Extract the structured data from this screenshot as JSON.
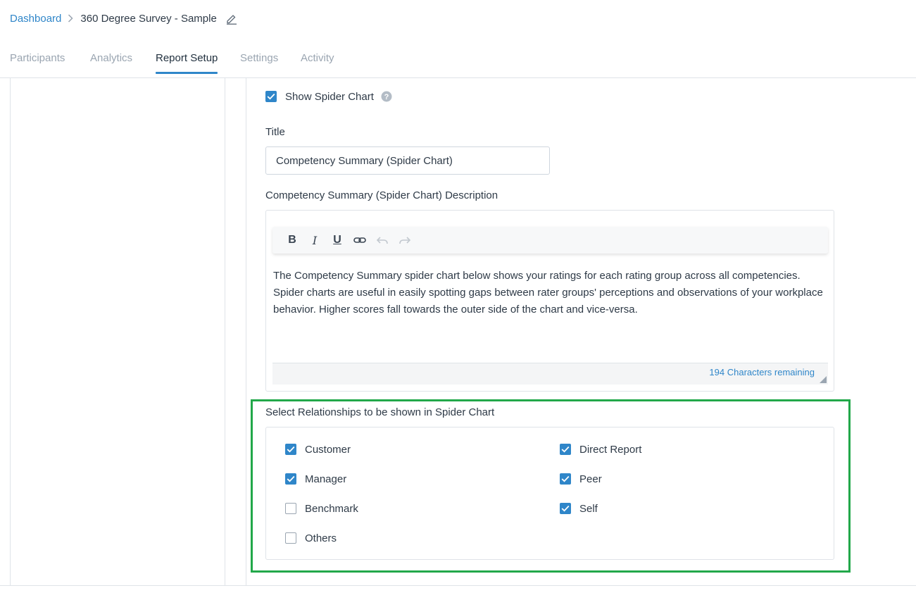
{
  "breadcrumb": {
    "root": "Dashboard",
    "current": "360 Degree Survey - Sample"
  },
  "tabs": [
    {
      "label": "Participants",
      "active": false
    },
    {
      "label": "Analytics",
      "active": false
    },
    {
      "label": "Report Setup",
      "active": true
    },
    {
      "label": "Settings",
      "active": false
    },
    {
      "label": "Activity",
      "active": false
    }
  ],
  "spider_chart": {
    "show_label": "Show Spider Chart",
    "show_checked": true,
    "title_label": "Title",
    "title_value": "Competency Summary (Spider Chart)",
    "description_label": "Competency Summary (Spider Chart) Description",
    "toolbar": {
      "bold": "B",
      "italic": "I",
      "underline": "U"
    },
    "description_text": "The Competency Summary spider chart below shows your ratings for each rating group across all competencies. Spider charts are useful in easily spotting gaps between rater groups' perceptions and observations of your workplace behavior. Higher scores fall towards the outer side of the chart and vice-versa.",
    "characters_remaining": "194 Characters remaining"
  },
  "relationships": {
    "label": "Select Relationships to be shown in Spider Chart",
    "items": [
      {
        "label": "Customer",
        "checked": true
      },
      {
        "label": "Manager",
        "checked": true
      },
      {
        "label": "Benchmark",
        "checked": false
      },
      {
        "label": "Others",
        "checked": false
      },
      {
        "label": "Direct Report",
        "checked": true
      },
      {
        "label": "Peer",
        "checked": true
      },
      {
        "label": "Self",
        "checked": true
      }
    ]
  },
  "colors": {
    "accent": "#2f86c9",
    "highlight": "#22a84a",
    "text": "#2e3a47",
    "muted": "#9aa5b1",
    "border": "#dfe3e8"
  }
}
